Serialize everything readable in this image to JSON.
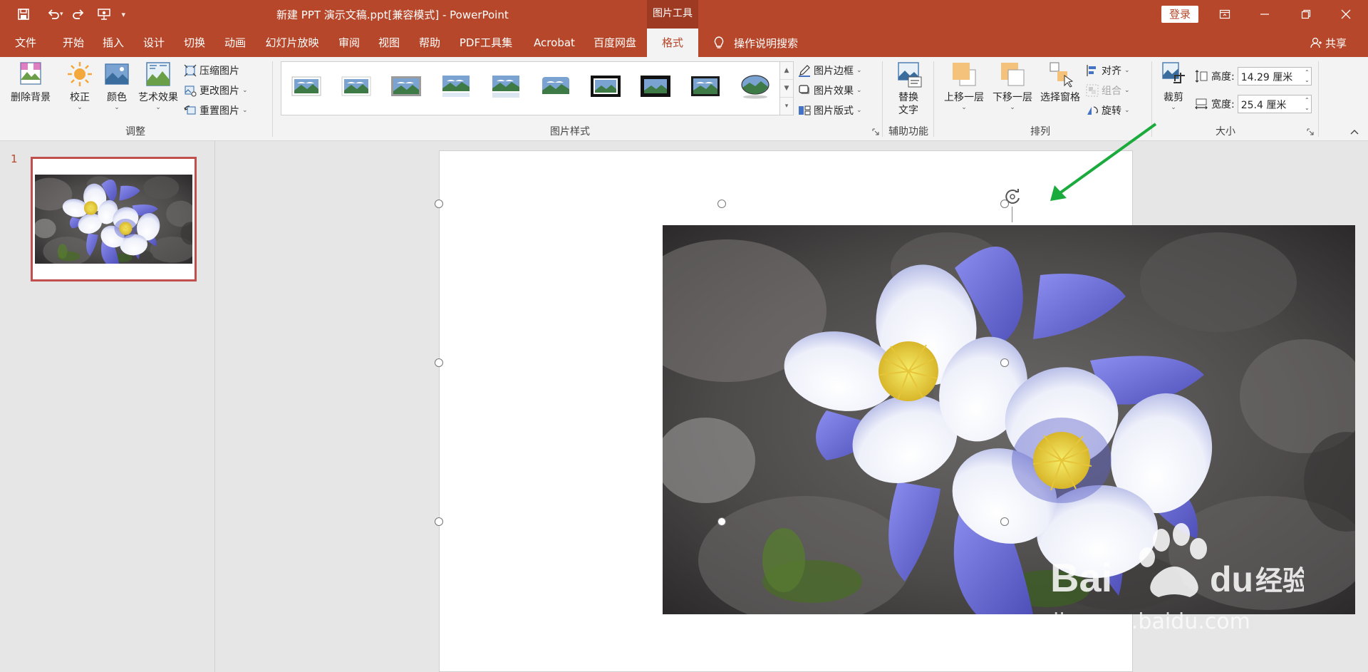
{
  "window": {
    "title": "新建 PPT 演示文稿.ppt[兼容模式] - PowerPoint",
    "context_tab_group": "图片工具",
    "login_label": "登录",
    "brand_color": "#b7472a"
  },
  "quick_access": [
    {
      "icon": "save-icon"
    },
    {
      "icon": "undo-icon"
    },
    {
      "icon": "redo-icon"
    },
    {
      "icon": "present-icon"
    },
    {
      "icon": "customize-qat-icon"
    }
  ],
  "tabs": [
    {
      "label": "文件"
    },
    {
      "label": "开始"
    },
    {
      "label": "插入"
    },
    {
      "label": "设计"
    },
    {
      "label": "切换"
    },
    {
      "label": "动画"
    },
    {
      "label": "幻灯片放映"
    },
    {
      "label": "审阅"
    },
    {
      "label": "视图"
    },
    {
      "label": "帮助"
    },
    {
      "label": "PDF工具集"
    },
    {
      "label": "Acrobat"
    },
    {
      "label": "百度网盘"
    },
    {
      "label": "格式",
      "active": true
    }
  ],
  "tell_me": "操作说明搜索",
  "share": "共享",
  "ribbon": {
    "adjust": {
      "label": "调整",
      "remove_bg": "删除背景",
      "corrections": "校正",
      "color": "颜色",
      "artistic": "艺术效果",
      "compress": "压缩图片",
      "change": "更改图片",
      "reset": "重置图片"
    },
    "styles": {
      "label": "图片样式",
      "border": "图片边框",
      "effects": "图片效果",
      "layout": "图片版式"
    },
    "accessibility": {
      "label": "辅助功能",
      "alt_text_line1": "替换",
      "alt_text_line2": "文字"
    },
    "arrange": {
      "label": "排列",
      "bring_forward": "上移一层",
      "send_backward": "下移一层",
      "selection_pane": "选择窗格",
      "align": "对齐",
      "group": "组合",
      "rotate": "旋转"
    },
    "size": {
      "label": "大小",
      "crop": "裁剪",
      "height_label": "高度:",
      "height_value": "14.29 厘米",
      "width_label": "宽度:",
      "width_value": "25.4 厘米"
    }
  },
  "slides_pane": {
    "slide_number": "1"
  },
  "watermark": {
    "brand": "Bai",
    "brand2": "du",
    "cn": "经验",
    "url": "jingyan.baidu.com"
  },
  "annotation": {
    "arrow_color": "#1aab3c"
  }
}
